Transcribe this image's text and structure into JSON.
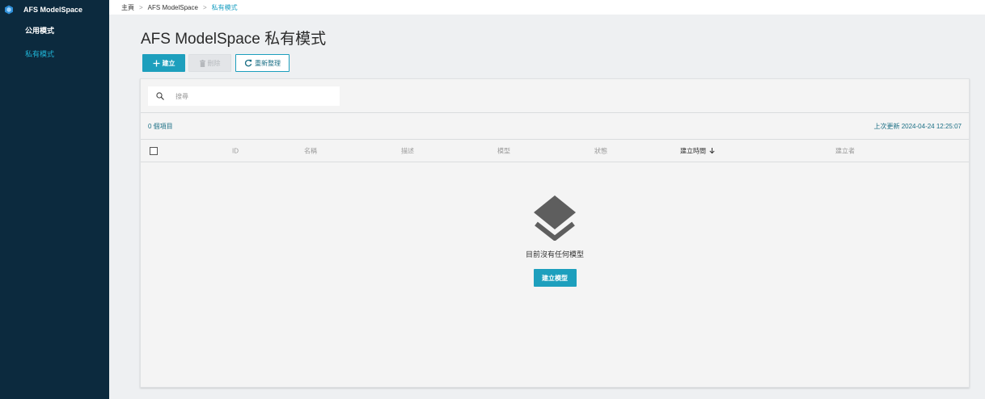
{
  "app": {
    "name": "AFS ModelSpace"
  },
  "sidebar": {
    "items": [
      {
        "label": "公用模式",
        "active": false
      },
      {
        "label": "私有模式",
        "active": true
      }
    ]
  },
  "breadcrumb": {
    "items": [
      "主頁",
      "AFS ModelSpace",
      "私有模式"
    ],
    "separator": ">"
  },
  "page": {
    "title": "AFS ModelSpace 私有模式"
  },
  "toolbar": {
    "create_label": "建立",
    "delete_label": "刪除",
    "refresh_label": "重新整理"
  },
  "search": {
    "placeholder": "搜尋"
  },
  "list": {
    "count_text": "0 個項目",
    "last_updated": "上次更新 2024-04-24 12:25:07"
  },
  "table": {
    "columns": [
      "ID",
      "名稱",
      "描述",
      "模型",
      "狀態",
      "建立時間",
      "建立者"
    ],
    "sort_column": "建立時間",
    "sort_direction": "desc"
  },
  "empty_state": {
    "message": "目前沒有任何模型",
    "button_label": "建立模型"
  },
  "colors": {
    "sidebar_bg": "#0c2a3e",
    "accent": "#1d9fbd",
    "active_nav": "#20b4d6",
    "link": "#1b6f85"
  },
  "icons": {
    "brand": "hexagon-logo-icon",
    "create": "plus-icon",
    "delete": "trash-icon",
    "refresh": "refresh-icon",
    "search": "search-icon",
    "sort": "arrow-down-icon",
    "empty": "layers-icon"
  }
}
